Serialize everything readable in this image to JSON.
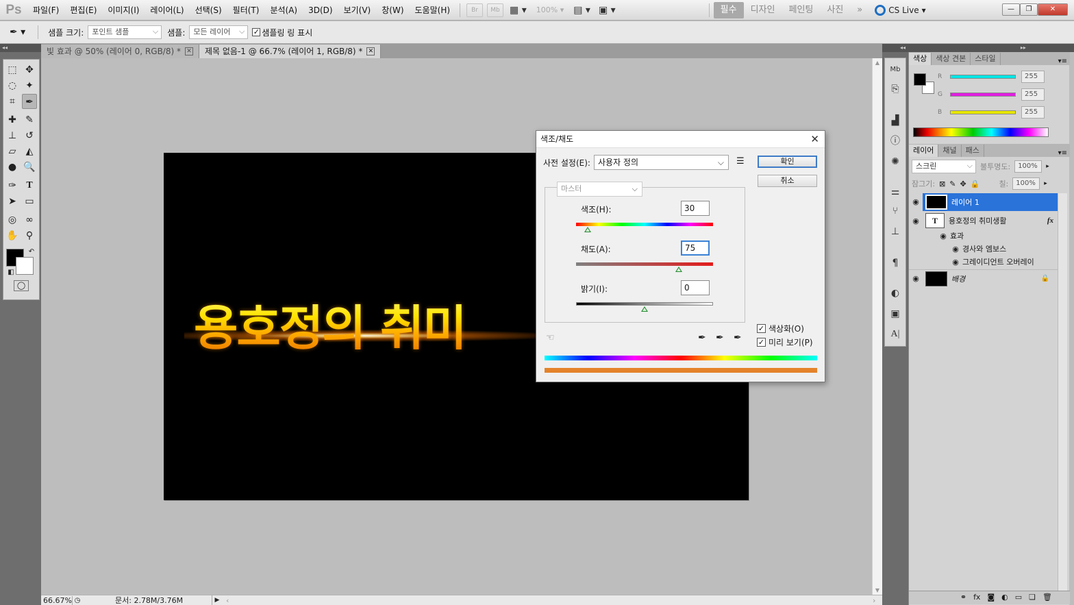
{
  "app": {
    "logo": "Ps",
    "menu": [
      "파일(F)",
      "편집(E)",
      "이미지(I)",
      "레이어(L)",
      "선택(S)",
      "필터(T)",
      "분석(A)",
      "3D(D)",
      "보기(V)",
      "창(W)",
      "도움말(H)"
    ],
    "bridge_btn": "Br",
    "mini_bridge_btn": "Mb",
    "zoom_level": "100%",
    "workspaces": [
      "필수",
      "디자인",
      "페인팅",
      "사진"
    ],
    "workspace_more": "»",
    "cs_live": "CS Live"
  },
  "options_bar": {
    "sample_size_label": "샘플 크기:",
    "sample_size_value": "포인트 샘플",
    "sample_label": "샘플:",
    "sample_value": "모든 레이어",
    "show_ring_label": "샘플링 링 표시"
  },
  "documents": {
    "tabs": [
      {
        "title": "빛 효과 @ 50% (레이어 0, RGB/8) *",
        "active": false
      },
      {
        "title": "제목 없음-1 @ 66.7% (레이어 1, RGB/8) *",
        "active": true
      }
    ],
    "canvas_text": "용호정의 취미"
  },
  "status_bar": {
    "zoom": "66.67%",
    "doc_info": "문서: 2.78M/3.76M"
  },
  "color_panel": {
    "tabs": [
      "색상",
      "색상 견본",
      "스타일"
    ],
    "channels": [
      {
        "label": "R",
        "value": "255",
        "color": "#00e5e5"
      },
      {
        "label": "G",
        "value": "255",
        "color": "#e01ee0"
      },
      {
        "label": "B",
        "value": "255",
        "color": "#e5e500"
      }
    ]
  },
  "layers_panel": {
    "tabs": [
      "레이어",
      "채널",
      "패스"
    ],
    "blend_mode": "스크린",
    "opacity_label": "불투명도:",
    "opacity_value": "100%",
    "lock_label": "잠그기:",
    "fill_label": "칠:",
    "fill_value": "100%",
    "layers": [
      {
        "name": "레이어 1",
        "selected": true
      },
      {
        "name": "용호정의 취미생활",
        "type": "T",
        "fx": "fx"
      },
      {
        "name": "효과"
      },
      {
        "name": "경사와 엠보스"
      },
      {
        "name": "그레이디언트 오버레이"
      },
      {
        "name": "배경"
      }
    ]
  },
  "dialog": {
    "title": "색조/채도",
    "preset_label": "사전 설정(E):",
    "preset_value": "사용자 정의",
    "ok_label": "확인",
    "cancel_label": "취소",
    "channel_value": "마스터",
    "hue_label": "색조(H):",
    "hue_value": "30",
    "saturation_label": "채도(A):",
    "saturation_value": "75",
    "lightness_label": "밝기(I):",
    "lightness_value": "0",
    "colorize_label": "색상화(O)",
    "colorize_checked": true,
    "preview_label": "미리 보기(P)",
    "preview_checked": true,
    "result_color": "#e4832a"
  }
}
